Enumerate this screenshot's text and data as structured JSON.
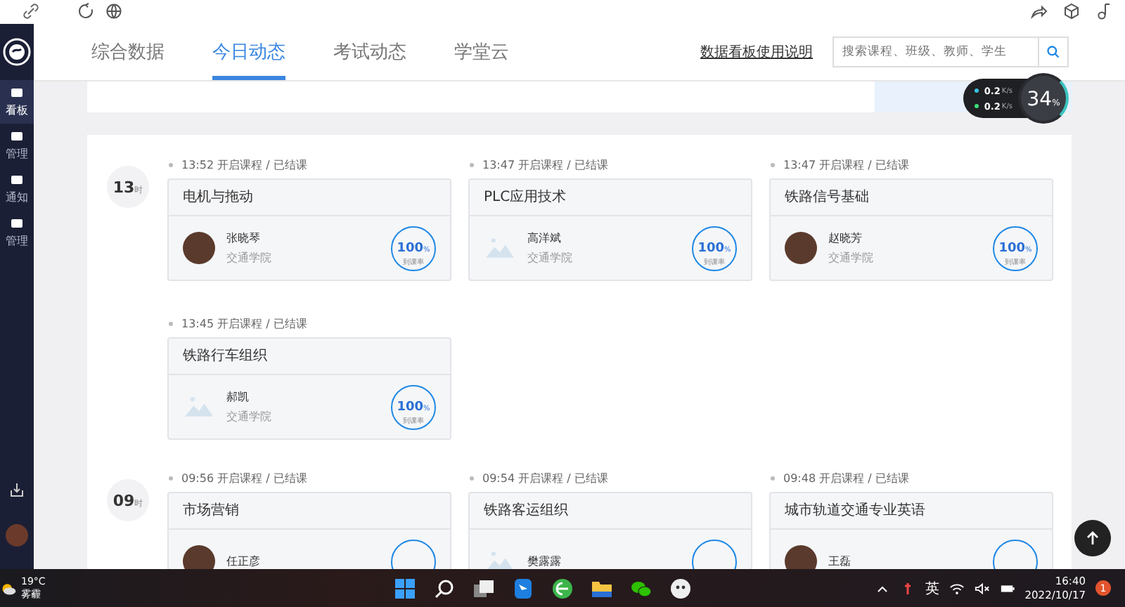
{
  "sidebar": {
    "items": [
      {
        "label": "看板",
        "selected": true
      },
      {
        "label": "管理",
        "selected": false
      },
      {
        "label": "通知",
        "selected": false
      },
      {
        "label": "管理",
        "selected": false
      }
    ]
  },
  "tabs": [
    {
      "label": "综合数据",
      "selected": false
    },
    {
      "label": "今日动态",
      "selected": true
    },
    {
      "label": "考试动态",
      "selected": false
    },
    {
      "label": "学堂云",
      "selected": false
    }
  ],
  "help_link": "数据看板使用说明",
  "search": {
    "placeholder": "搜索课程、班级、教师、学生"
  },
  "network_widget": {
    "upload": "0.2",
    "upload_unit": "K/s",
    "download": "0.2",
    "download_unit": "K/s",
    "percent": "34",
    "percent_unit": "%"
  },
  "groups": [
    {
      "hour": "13",
      "hour_unit": "时",
      "sessions": [
        {
          "time": "13:52",
          "status": "开启课程 / 已结课",
          "course": "电机与拖动",
          "teacher": "张晓琴",
          "dept": "交通学院",
          "photo": true,
          "rate": "100",
          "rate_unit": "%",
          "rate_label": "到课率"
        },
        {
          "time": "13:47",
          "status": "开启课程 / 已结课",
          "course": "PLC应用技术",
          "teacher": "高洋斌",
          "dept": "交通学院",
          "photo": false,
          "rate": "100",
          "rate_unit": "%",
          "rate_label": "到课率"
        },
        {
          "time": "13:47",
          "status": "开启课程 / 已结课",
          "course": "铁路信号基础",
          "teacher": "赵晓芳",
          "dept": "交通学院",
          "photo": true,
          "rate": "100",
          "rate_unit": "%",
          "rate_label": "到课率"
        },
        {
          "time": "13:45",
          "status": "开启课程 / 已结课",
          "course": "铁路行车组织",
          "teacher": "郝凯",
          "dept": "交通学院",
          "photo": false,
          "rate": "100",
          "rate_unit": "%",
          "rate_label": "到课率"
        }
      ]
    },
    {
      "hour": "09",
      "hour_unit": "时",
      "sessions": [
        {
          "time": "09:56",
          "status": "开启课程 / 已结课",
          "course": "市场营销",
          "teacher": "任正彦",
          "photo": true
        },
        {
          "time": "09:54",
          "status": "开启课程 / 已结课",
          "course": "铁路客运组织",
          "teacher": "樊露露",
          "photo": false
        },
        {
          "time": "09:48",
          "status": "开启课程 / 已结课",
          "course": "城市轨道交通专业英语",
          "teacher": "王磊",
          "photo": true
        }
      ]
    }
  ],
  "taskbar": {
    "temperature": "19°C",
    "weather": "雾霾",
    "ime": "英",
    "time": "16:40",
    "date": "2022/10/17",
    "badge": "1"
  }
}
